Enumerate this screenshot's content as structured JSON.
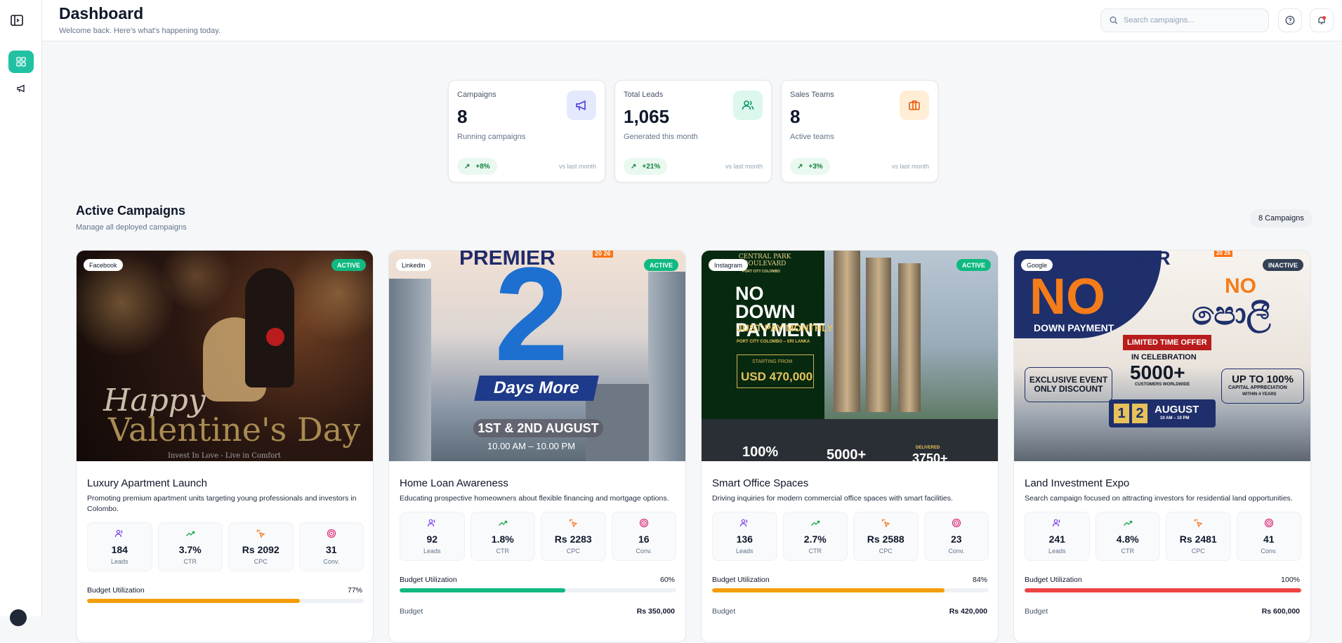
{
  "header": {
    "title": "Dashboard",
    "subtitle": "Welcome back. Here's what's happening today.",
    "search_placeholder": "Search campaigns..."
  },
  "sidebar": {
    "items": [
      {
        "icon": "dashboard-icon",
        "active": true
      },
      {
        "icon": "megaphone-icon",
        "active": false
      }
    ]
  },
  "stats": [
    {
      "label": "Campaigns",
      "value": "8",
      "desc": "Running campaigns",
      "change": "+8%",
      "vs": "vs last month",
      "icon": "megaphone-icon"
    },
    {
      "label": "Total Leads",
      "value": "1,065",
      "desc": "Generated this month",
      "change": "+21%",
      "vs": "vs last month",
      "icon": "users-icon"
    },
    {
      "label": "Sales Teams",
      "value": "8",
      "desc": "Active teams",
      "change": "+3%",
      "vs": "vs last month",
      "icon": "briefcase-icon"
    }
  ],
  "section": {
    "title": "Active Campaigns",
    "subtitle": "Manage all deployed campaigns",
    "count": "8 Campaigns"
  },
  "metric_labels": {
    "leads": "Leads",
    "ctr": "CTR",
    "cpc": "CPC",
    "conv": "Conv."
  },
  "labels": {
    "budget_utilization": "Budget Utilization",
    "budget": "Budget"
  },
  "campaigns": [
    {
      "platform": "Facebook",
      "status": "ACTIVE",
      "name": "Luxury Apartment Launch",
      "desc": "Promoting premium apartment units targeting young professionals and investors in Colombo.",
      "leads": "184",
      "ctr": "3.7%",
      "cpc": "Rs 2092",
      "conv": "31",
      "utilization": "77%",
      "utilization_value": 0.77,
      "budget": "",
      "bar_color": "#f59e0b",
      "image_text": {
        "line1": "Happy",
        "line2": "Valentine's Day",
        "tagline": "Invest In Love - Live in Comfort"
      }
    },
    {
      "platform": "Linkedin",
      "status": "ACTIVE",
      "name": "Home Loan Awareness",
      "desc": "Educating prospective homeowners about flexible financing and mortgage options.",
      "leads": "92",
      "ctr": "1.8%",
      "cpc": "Rs 2283",
      "conv": "16",
      "utilization": "60%",
      "utilization_value": 0.6,
      "budget": "Rs 350,000",
      "bar_color": "#10b981",
      "image_text": {
        "brand": "PREMIER",
        "year": "20 26",
        "number": "2",
        "banner": "Days More",
        "dates": "1ST & 2ND AUGUST",
        "time": "10.00 AM – 10.00 PM"
      }
    },
    {
      "platform": "Instagram",
      "status": "ACTIVE",
      "name": "Smart Office Spaces",
      "desc": "Driving inquiries for modern commercial office spaces with smart facilities.",
      "leads": "136",
      "ctr": "2.7%",
      "cpc": "Rs 2588",
      "conv": "23",
      "utilization": "84%",
      "utilization_value": 0.84,
      "budget": "Rs 420,000",
      "bar_color": "#f59e0b",
      "image_text": {
        "brand": "CENTRAL PARK BOULEVARD",
        "sub": "PORT CITY COLOMBO",
        "headline": "NO DOWN PAYMENT",
        "subline": "JUST PAY MONTHLY",
        "location": "PORT CITY COLOMBO – SRI LANKA",
        "starting": "STARTING FROM",
        "price": "USD 470,000",
        "stat1": "100%",
        "stat2": "5000+",
        "stat3_label": "DELIVERED",
        "stat3": "3750+"
      }
    },
    {
      "platform": "Google",
      "status": "INACTIVE",
      "name": "Land Investment Expo",
      "desc": "Search campaign focused on attracting investors for residential land opportunities.",
      "leads": "241",
      "ctr": "4.8%",
      "cpc": "Rs 2481",
      "conv": "41",
      "utilization": "100%",
      "utilization_value": 1.0,
      "budget": "Rs 600,000",
      "bar_color": "#ef4444",
      "image_text": {
        "brand": "PREMIER",
        "year": "20 26",
        "big": "NO",
        "down": "DOWN PAYMENT",
        "no2": "NO",
        "sinhala": "පොලී",
        "offer": "LIMITED TIME OFFER",
        "celebration": "IN CELEBRATION",
        "count": "5000+",
        "customers": "CUSTOMERS WORLDWIDE",
        "exclusive": "EXCLUSIVE EVENT ONLY DISCOUNT",
        "appreciation": "UP TO 100%",
        "appreciation_sub": "CAPITAL APPRECIATION",
        "within": "WITHIN 4 YEARS",
        "date_a": "1",
        "date_b": "2",
        "month": "AUGUST",
        "time": "10 AM – 10 PM"
      }
    }
  ],
  "colors": {
    "accent": "#22c1a4",
    "active": "#10b981",
    "inactive": "#334155"
  }
}
